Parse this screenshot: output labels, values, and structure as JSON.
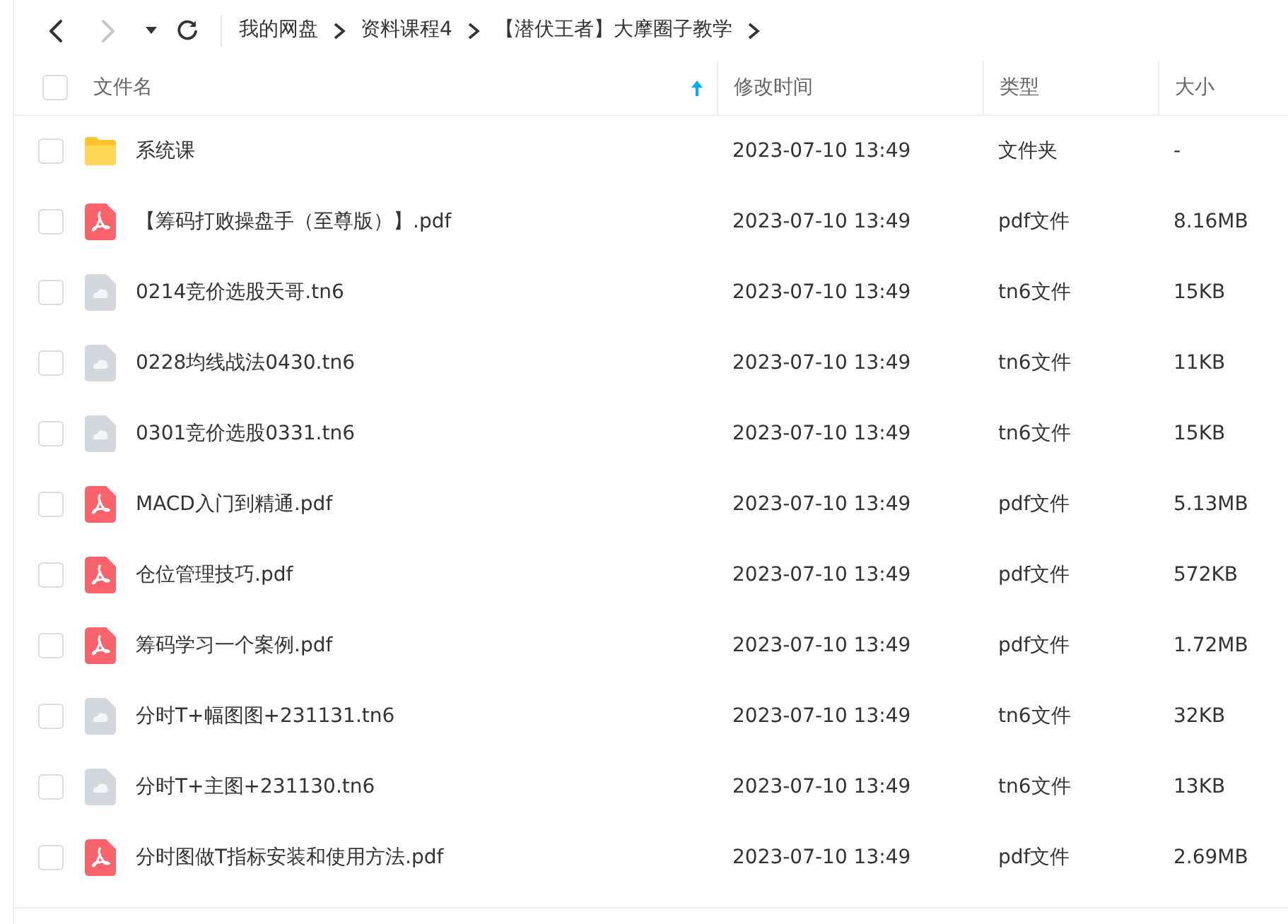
{
  "toolbar": {
    "back": {
      "disabled": false
    },
    "forward": {
      "disabled": true
    }
  },
  "breadcrumb": [
    "我的网盘",
    "资料课程4",
    "【潜伏王者】大摩圈子教学"
  ],
  "table": {
    "select_all": {
      "checked": false
    },
    "columns": [
      {
        "label": "文件名",
        "sorted": true
      },
      {
        "label": "修改时间",
        "sorted": false
      },
      {
        "label": "类型",
        "sorted": false
      },
      {
        "label": "大小",
        "sorted": false
      }
    ],
    "rows": [
      {
        "kind": "folder",
        "checked": false,
        "name": "系统课",
        "modified": "2023-07-10 13:49",
        "type": "文件夹",
        "size": "-"
      },
      {
        "kind": "pdf",
        "checked": false,
        "name": "【筹码打败操盘手（至尊版）】.pdf",
        "modified": "2023-07-10 13:49",
        "type": "pdf文件",
        "size": "8.16MB"
      },
      {
        "kind": "file",
        "checked": false,
        "name": "0214竞价选股天哥.tn6",
        "modified": "2023-07-10 13:49",
        "type": "tn6文件",
        "size": "15KB"
      },
      {
        "kind": "file",
        "checked": false,
        "name": "0228均线战法0430.tn6",
        "modified": "2023-07-10 13:49",
        "type": "tn6文件",
        "size": "11KB"
      },
      {
        "kind": "file",
        "checked": false,
        "name": "0301竞价选股0331.tn6",
        "modified": "2023-07-10 13:49",
        "type": "tn6文件",
        "size": "15KB"
      },
      {
        "kind": "pdf",
        "checked": false,
        "name": "MACD入门到精通.pdf",
        "modified": "2023-07-10 13:49",
        "type": "pdf文件",
        "size": "5.13MB"
      },
      {
        "kind": "pdf",
        "checked": false,
        "name": "仓位管理技巧.pdf",
        "modified": "2023-07-10 13:49",
        "type": "pdf文件",
        "size": "572KB"
      },
      {
        "kind": "pdf",
        "checked": false,
        "name": "筹码学习一个案例.pdf",
        "modified": "2023-07-10 13:49",
        "type": "pdf文件",
        "size": "1.72MB"
      },
      {
        "kind": "file",
        "checked": false,
        "name": "分时T+幅图图+231131.tn6",
        "modified": "2023-07-10 13:49",
        "type": "tn6文件",
        "size": "32KB"
      },
      {
        "kind": "file",
        "checked": false,
        "name": "分时T+主图+231130.tn6",
        "modified": "2023-07-10 13:49",
        "type": "tn6文件",
        "size": "13KB"
      },
      {
        "kind": "pdf",
        "checked": false,
        "name": "分时图做T指标安装和使用方法.pdf",
        "modified": "2023-07-10 13:49",
        "type": "pdf文件",
        "size": "2.69MB"
      }
    ]
  }
}
